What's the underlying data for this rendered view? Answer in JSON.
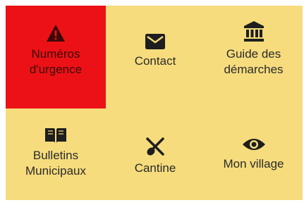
{
  "colors": {
    "panel_background": "#f6dc7d",
    "emergency_background": "#ec1116",
    "icon": "#1e1e1e"
  },
  "tiles": [
    {
      "label": "Numéros\nd'urgence",
      "icon": "warning-icon",
      "highlighted": true
    },
    {
      "label": "Contact",
      "icon": "envelope-icon",
      "highlighted": false
    },
    {
      "label": "Guide des\ndémarches",
      "icon": "bank-icon",
      "highlighted": false
    },
    {
      "label": "Bulletins\nMunicipaux",
      "icon": "book-icon",
      "highlighted": false
    },
    {
      "label": "Cantine",
      "icon": "utensils-icon",
      "highlighted": false
    },
    {
      "label": "Mon village",
      "icon": "eye-icon",
      "highlighted": false
    }
  ]
}
